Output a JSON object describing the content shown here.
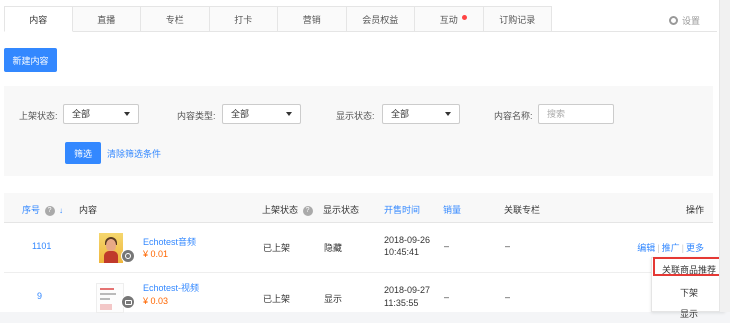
{
  "tabs": [
    {
      "label": "内容",
      "active": true
    },
    {
      "label": "直播"
    },
    {
      "label": "专栏"
    },
    {
      "label": "打卡"
    },
    {
      "label": "营销"
    },
    {
      "label": "会员权益"
    },
    {
      "label": "互动",
      "badge_dot": true
    },
    {
      "label": "订购记录"
    }
  ],
  "settings_label": "设置",
  "new_button": "新建内容",
  "filters": {
    "status_label": "上架状态:",
    "status_value": "全部",
    "type_label": "内容类型:",
    "type_value": "全部",
    "display_label": "显示状态:",
    "display_value": "全部",
    "name_label": "内容名称:",
    "name_placeholder": "搜索",
    "filter_button": "筛选",
    "clear_link": "清除筛选条件"
  },
  "table": {
    "headers": {
      "seq": "序号",
      "content": "内容",
      "shelf_status": "上架状态",
      "display_status": "显示状态",
      "sale_time": "开售时间",
      "sales": "销量",
      "column": "关联专栏",
      "ops": "操作"
    },
    "rows": [
      {
        "seq": "1101",
        "title": "Echotest音频",
        "price": "¥ 0.01",
        "shelf": "已上架",
        "display": "隐藏",
        "date": "2018-09-26",
        "time": "10:45:41",
        "sales": "–",
        "column": "–",
        "media": "audio"
      },
      {
        "seq": "9",
        "title": "Echotest-视频",
        "price": "¥ 0.03",
        "shelf": "已上架",
        "display": "显示",
        "date": "2018-09-27",
        "time": "11:35:55",
        "sales": "–",
        "column": "–",
        "media": "video"
      }
    ],
    "ops": {
      "edit": "编辑",
      "promote": "推广",
      "more": "更多"
    }
  },
  "more_menu": [
    "关联商品推荐",
    "下架",
    "显示"
  ],
  "colors": {
    "accent": "#3388ff",
    "price": "#ff6600",
    "highlight": "#e53935"
  }
}
